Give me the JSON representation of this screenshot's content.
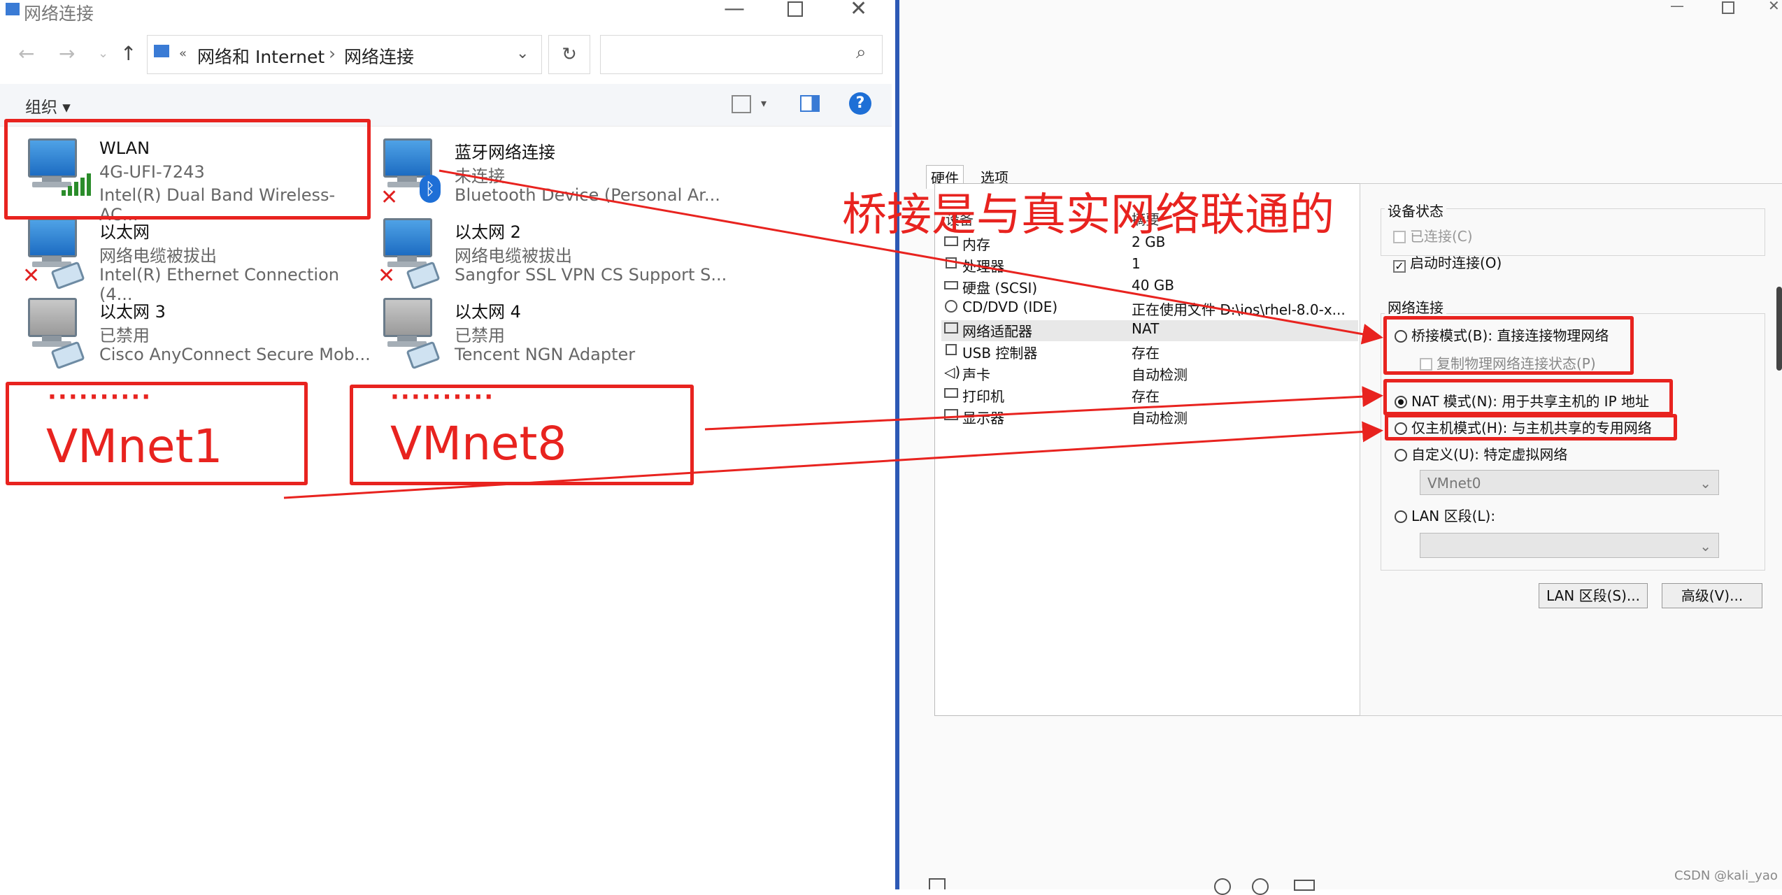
{
  "window": {
    "title": "网络连接"
  },
  "address": {
    "overflow": "«",
    "crumb1": "网络和 Internet",
    "sep": "›",
    "crumb2": "网络连接"
  },
  "toolbar": {
    "organize": "组织 ▾",
    "help": "?"
  },
  "connections": [
    {
      "name": "WLAN",
      "status": "4G-UFI-7243",
      "device": "Intel(R) Dual Band Wireless-AC..."
    },
    {
      "name": "蓝牙网络连接",
      "status": "未连接",
      "device": "Bluetooth Device (Personal Ar..."
    },
    {
      "name": "以太网",
      "status": "网络电缆被拔出",
      "device": "Intel(R) Ethernet Connection (4..."
    },
    {
      "name": "以太网 2",
      "status": "网络电缆被拔出",
      "device": "Sangfor SSL VPN CS Support S..."
    },
    {
      "name": "以太网 3",
      "status": "已禁用",
      "device": "Cisco AnyConnect Secure Mob..."
    },
    {
      "name": "以太网 4",
      "status": "已禁用",
      "device": "Tencent NGN Adapter"
    }
  ],
  "annotations": {
    "dots": "··········",
    "vmnet1": "VMnet1",
    "vmnet8": "VMnet8",
    "bridge_note": "桥接是与真实网络联通的"
  },
  "dialog": {
    "tabs": [
      "硬件",
      "选项"
    ],
    "columns": {
      "device": "设备",
      "summary": "摘要"
    },
    "hardware": [
      {
        "name": "内存",
        "value": "2 GB"
      },
      {
        "name": "处理器",
        "value": "1"
      },
      {
        "name": "硬盘 (SCSI)",
        "value": "40 GB"
      },
      {
        "name": "CD/DVD (IDE)",
        "value": "正在使用文件 D:\\ios\\rhel-8.0-x..."
      },
      {
        "name": "网络适配器",
        "value": "NAT"
      },
      {
        "name": "USB 控制器",
        "value": "存在"
      },
      {
        "name": "声卡",
        "value": "自动检测"
      },
      {
        "name": "打印机",
        "value": "存在"
      },
      {
        "name": "显示器",
        "value": "自动检测"
      }
    ],
    "device_status": {
      "title": "设备状态",
      "connected": "已连接(C)",
      "connect_on_power": "启动时连接(O)"
    },
    "network": {
      "title": "网络连接",
      "bridged": "桥接模式(B): 直接连接物理网络",
      "replicate": "复制物理网络连接状态(P)",
      "nat": "NAT 模式(N): 用于共享主机的 IP 地址",
      "hostonly": "仅主机模式(H): 与主机共享的专用网络",
      "custom": "自定义(U): 特定虚拟网络",
      "custom_value": "VMnet0",
      "lan": "LAN 区段(L):"
    },
    "buttons": {
      "lan_segments": "LAN 区段(S)...",
      "advanced": "高级(V)..."
    }
  },
  "watermark": "CSDN @kali_yao"
}
